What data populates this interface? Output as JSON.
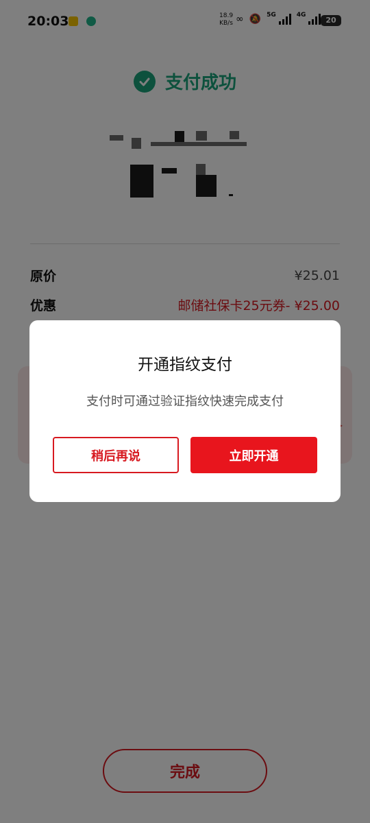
{
  "status_bar": {
    "time": "20:03",
    "net_speed": "18.9",
    "net_speed_unit": "KB/s",
    "net_5g": "5G",
    "net_4g": "4G",
    "battery": "20"
  },
  "result": {
    "title": "支付成功",
    "icon": "check-circle-icon"
  },
  "details": {
    "original_price_label": "原价",
    "original_price_value": "¥25.01",
    "discount_label": "优惠",
    "discount_value": "邮储社保卡25元券- ¥25.00"
  },
  "footer": {
    "done_label": "完成"
  },
  "dialog": {
    "title": "开通指纹支付",
    "description": "支付时可通过验证指纹快速完成支付",
    "later_label": "稍后再说",
    "open_label": "立即开通"
  },
  "colors": {
    "success": "#1aa37a",
    "accent": "#e8151d",
    "overlay": "rgba(0,0,0,0.5)"
  }
}
